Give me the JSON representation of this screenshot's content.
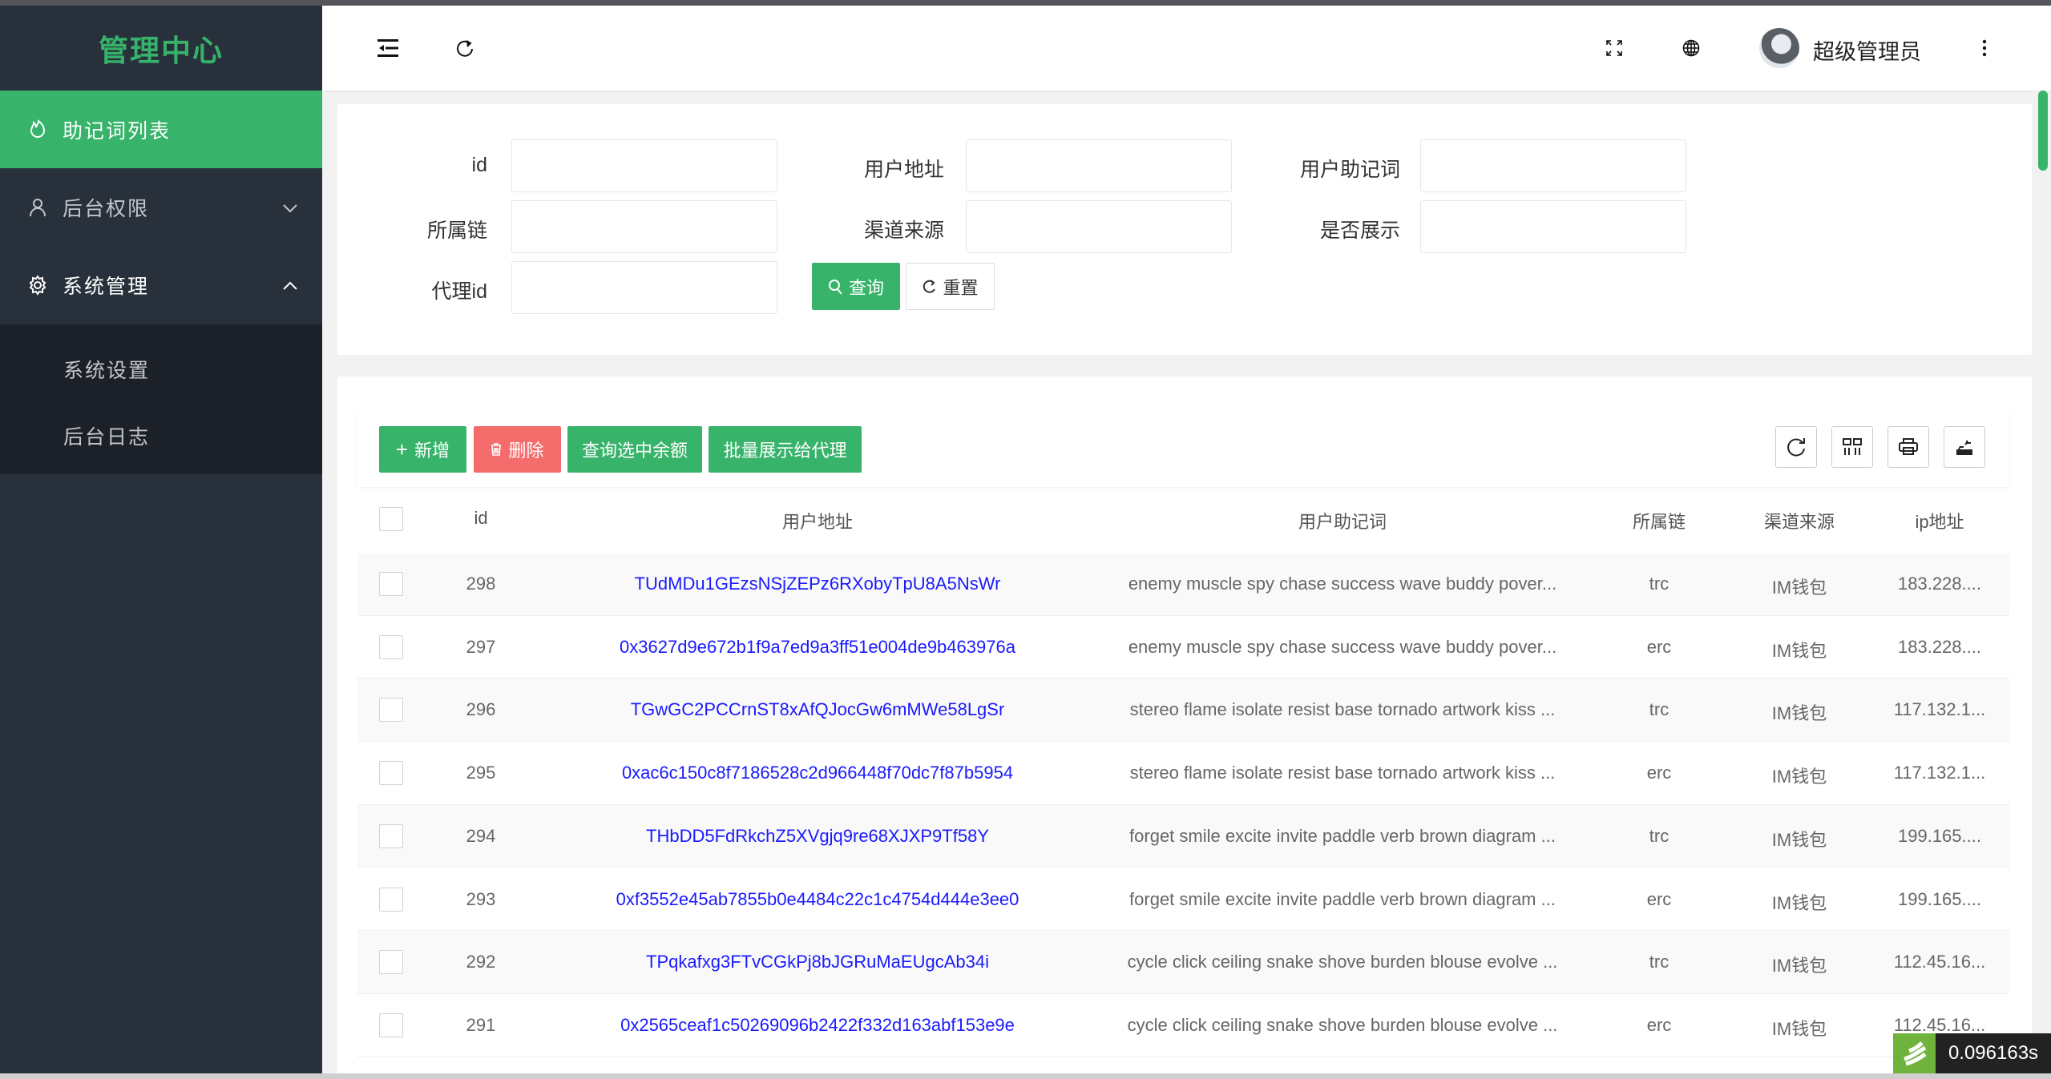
{
  "sidebar": {
    "title": "管理中心",
    "items": [
      {
        "label": "助记词列表",
        "icon": "fire-icon",
        "active": true
      },
      {
        "label": "后台权限",
        "icon": "user-icon",
        "expanded": false
      },
      {
        "label": "系统管理",
        "icon": "gear-icon",
        "expanded": true,
        "children": [
          {
            "label": "系统设置"
          },
          {
            "label": "后台日志"
          }
        ]
      }
    ]
  },
  "header": {
    "username": "超级管理员"
  },
  "search": {
    "fields": [
      {
        "label": "id",
        "value": ""
      },
      {
        "label": "用户地址",
        "value": ""
      },
      {
        "label": "用户助记词",
        "value": ""
      },
      {
        "label": "所属链",
        "value": ""
      },
      {
        "label": "渠道来源",
        "value": ""
      },
      {
        "label": "是否展示",
        "value": ""
      },
      {
        "label": "代理id",
        "value": ""
      }
    ],
    "query_label": "查询",
    "reset_label": "重置"
  },
  "toolbar": {
    "add_label": "新增",
    "delete_label": "删除",
    "query_balance_label": "查询选中余额",
    "batch_show_label": "批量展示给代理"
  },
  "table": {
    "columns": [
      "id",
      "用户地址",
      "用户助记词",
      "所属链",
      "渠道来源",
      "ip地址"
    ],
    "rows": [
      {
        "id": "298",
        "address": "TUdMDu1GEzsNSjZEPz6RXobyTpU8A5NsWr",
        "mnemonic": "enemy muscle spy chase success wave buddy pover...",
        "chain": "trc",
        "source": "IM钱包",
        "ip": "183.228...."
      },
      {
        "id": "297",
        "address": "0x3627d9e672b1f9a7ed9a3ff51e004de9b463976a",
        "mnemonic": "enemy muscle spy chase success wave buddy pover...",
        "chain": "erc",
        "source": "IM钱包",
        "ip": "183.228...."
      },
      {
        "id": "296",
        "address": "TGwGC2PCCrnST8xAfQJocGw6mMWe58LgSr",
        "mnemonic": "stereo flame isolate resist base tornado artwork kiss ...",
        "chain": "trc",
        "source": "IM钱包",
        "ip": "117.132.1..."
      },
      {
        "id": "295",
        "address": "0xac6c150c8f7186528c2d966448f70dc7f87b5954",
        "mnemonic": "stereo flame isolate resist base tornado artwork kiss ...",
        "chain": "erc",
        "source": "IM钱包",
        "ip": "117.132.1..."
      },
      {
        "id": "294",
        "address": "THbDD5FdRkchZ5XVgjq9re68XJXP9Tf58Y",
        "mnemonic": "forget smile excite invite paddle verb brown diagram ...",
        "chain": "trc",
        "source": "IM钱包",
        "ip": "199.165...."
      },
      {
        "id": "293",
        "address": "0xf3552e45ab7855b0e4484c22c1c4754d444e3ee0",
        "mnemonic": "forget smile excite invite paddle verb brown diagram ...",
        "chain": "erc",
        "source": "IM钱包",
        "ip": "199.165...."
      },
      {
        "id": "292",
        "address": "TPqkafxg3FTvCGkPj8bJGRuMaEUgcAb34i",
        "mnemonic": "cycle click ceiling snake shove burden blouse evolve ...",
        "chain": "trc",
        "source": "IM钱包",
        "ip": "112.45.16..."
      },
      {
        "id": "291",
        "address": "0x2565ceaf1c50269096b2422f332d163abf153e9e",
        "mnemonic": "cycle click ceiling snake shove burden blouse evolve ...",
        "chain": "erc",
        "source": "IM钱包",
        "ip": "112.45.16..."
      }
    ]
  },
  "timing_badge": "0.096163s",
  "colors": {
    "accent": "#37b36a",
    "danger": "#f56c6c",
    "sidebar": "#28313b",
    "link": "#1a1aff"
  }
}
